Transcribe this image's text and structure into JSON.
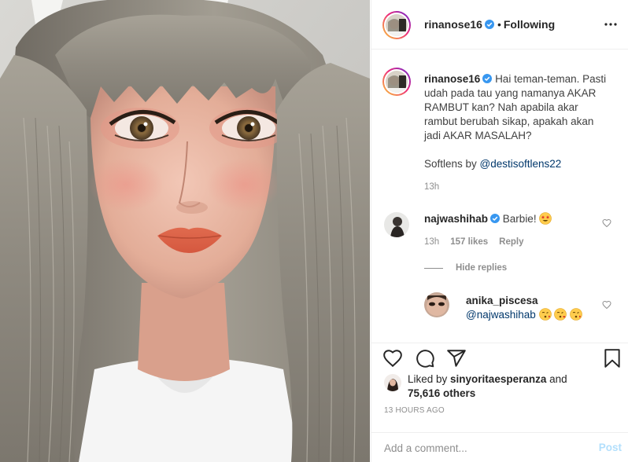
{
  "post": {
    "author": "rinanose16",
    "follow_status": "Following",
    "separator": "•"
  },
  "caption": {
    "username": "rinanose16",
    "text": "Hai teman-teman. Pasti udah pada tau yang namanya AKAR RAMBUT kan? Nah apabila akar rambut berubah sikap, apakah akan jadi AKAR MASALAH?",
    "softlens_prefix": "Softlens by ",
    "softlens_mention": "@destisoftlens22",
    "time": "13h"
  },
  "comments": [
    {
      "username": "najwashihab",
      "text": "Barbie!",
      "time": "13h",
      "likes": "157 likes",
      "reply_label": "Reply"
    }
  ],
  "hide_replies_label": "Hide replies",
  "replies": [
    {
      "username": "anika_piscesa",
      "mention": "@najwashihab"
    }
  ],
  "likes": {
    "prefix": "Liked by ",
    "by_user": "sinyoritaesperanza",
    "joiner": " and",
    "others": "75,616 others"
  },
  "post_time": "13 HOURS AGO",
  "add_comment": {
    "placeholder": "Add a comment...",
    "post_label": "Post"
  },
  "colors": {
    "verified": "#3897f0",
    "link": "#00376b",
    "muted": "#8e8e8e",
    "post_disabled": "#b2dffc"
  },
  "icons": [
    "more-options-icon",
    "heart-icon",
    "comment-icon",
    "share-icon",
    "bookmark-icon",
    "verified-badge-icon"
  ]
}
